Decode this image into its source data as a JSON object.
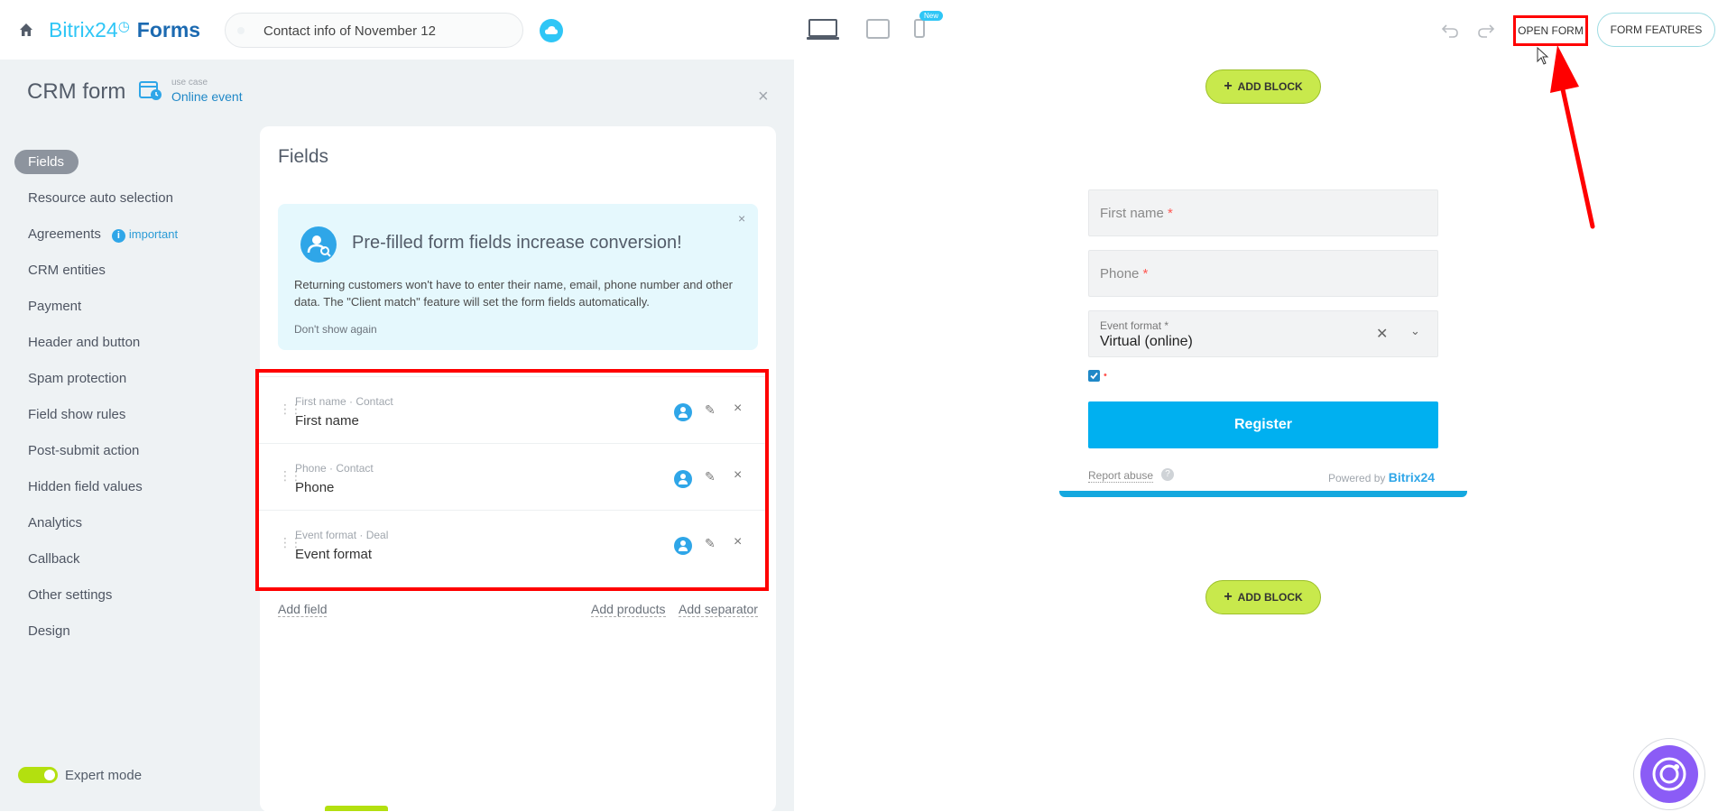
{
  "header": {
    "logo_brand": "Bitrix24",
    "logo_product": "Forms",
    "form_name": "Contact info of November 12",
    "new_badge": "New",
    "open_form_label": "OPEN FORM",
    "form_features_label": "FORM FEATURES"
  },
  "panel": {
    "title": "CRM form",
    "use_case_caption": "use case",
    "use_case_value": "Online event",
    "nav": [
      {
        "label": "Fields"
      },
      {
        "label": "Resource auto selection"
      },
      {
        "label": "Agreements",
        "badge": "important"
      },
      {
        "label": "CRM entities"
      },
      {
        "label": "Payment"
      },
      {
        "label": "Header and button"
      },
      {
        "label": "Spam protection"
      },
      {
        "label": "Field show rules"
      },
      {
        "label": "Post-submit action"
      },
      {
        "label": "Hidden field values"
      },
      {
        "label": "Analytics"
      },
      {
        "label": "Callback"
      },
      {
        "label": "Other settings"
      },
      {
        "label": "Design"
      }
    ],
    "expert_mode_label": "Expert mode"
  },
  "fields_card": {
    "title": "Fields",
    "promo": {
      "title": "Pre-filled form fields increase conversion!",
      "text": "Returning customers won't have to enter their name, email, phone number and other data. The \"Client match\" feature will set the form fields automatically.",
      "dismiss": "Don't show again"
    },
    "fields": [
      {
        "caption": "First name · Contact",
        "value": "First name"
      },
      {
        "caption": "Phone · Contact",
        "value": "Phone"
      },
      {
        "caption": "Event format · Deal",
        "value": "Event format"
      }
    ],
    "add_field": "Add field",
    "add_products": "Add products",
    "add_separator": "Add separator"
  },
  "preview": {
    "add_block_label": "ADD BLOCK",
    "first_name_placeholder": "First name",
    "phone_placeholder": "Phone",
    "required_mark": "*",
    "event_format_caption": "Event format",
    "event_format_value": "Virtual (online)",
    "register_label": "Register",
    "report_abuse": "Report abuse",
    "help_mark": "?",
    "powered_by": "Powered by",
    "powered_brand": "Bitrix24"
  },
  "colors": {
    "accent": "#2fc6f6",
    "add_block_green": "#c8e94c",
    "register_blue": "#00b0f0",
    "highlight_red": "#ff0000"
  }
}
